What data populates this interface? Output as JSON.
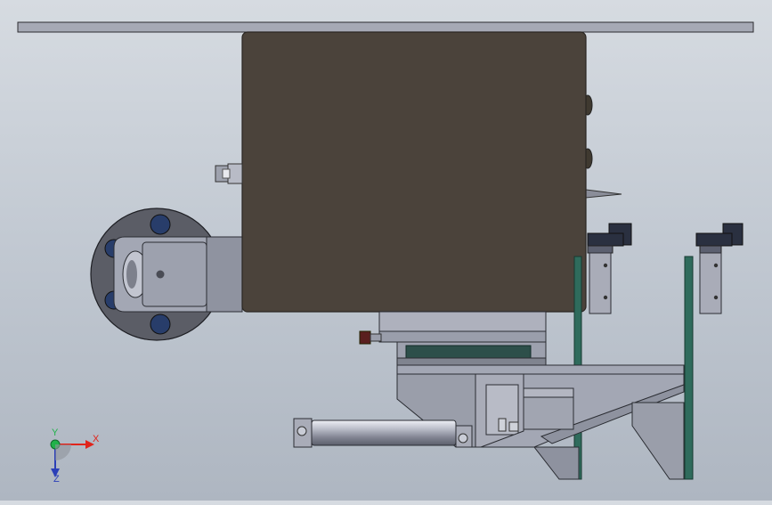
{
  "viewport": {
    "background_top": "#d6dbe1",
    "background_bottom": "#aeb6c1",
    "part_colors": {
      "body_fill": "#4b433b",
      "body_edge": "#2a2622",
      "steel": "#a3a7b4",
      "steel_dark": "#6d717c",
      "rail_green": "#2f6b5c",
      "bolt_blue": "#283d6a",
      "bolt_red": "#5a1f1f"
    }
  },
  "triad": {
    "x_label": "X",
    "y_label": "Y",
    "z_label": "Z",
    "x_color": "#e0241b",
    "y_color": "#21b24a",
    "z_color": "#2b3fb8"
  }
}
